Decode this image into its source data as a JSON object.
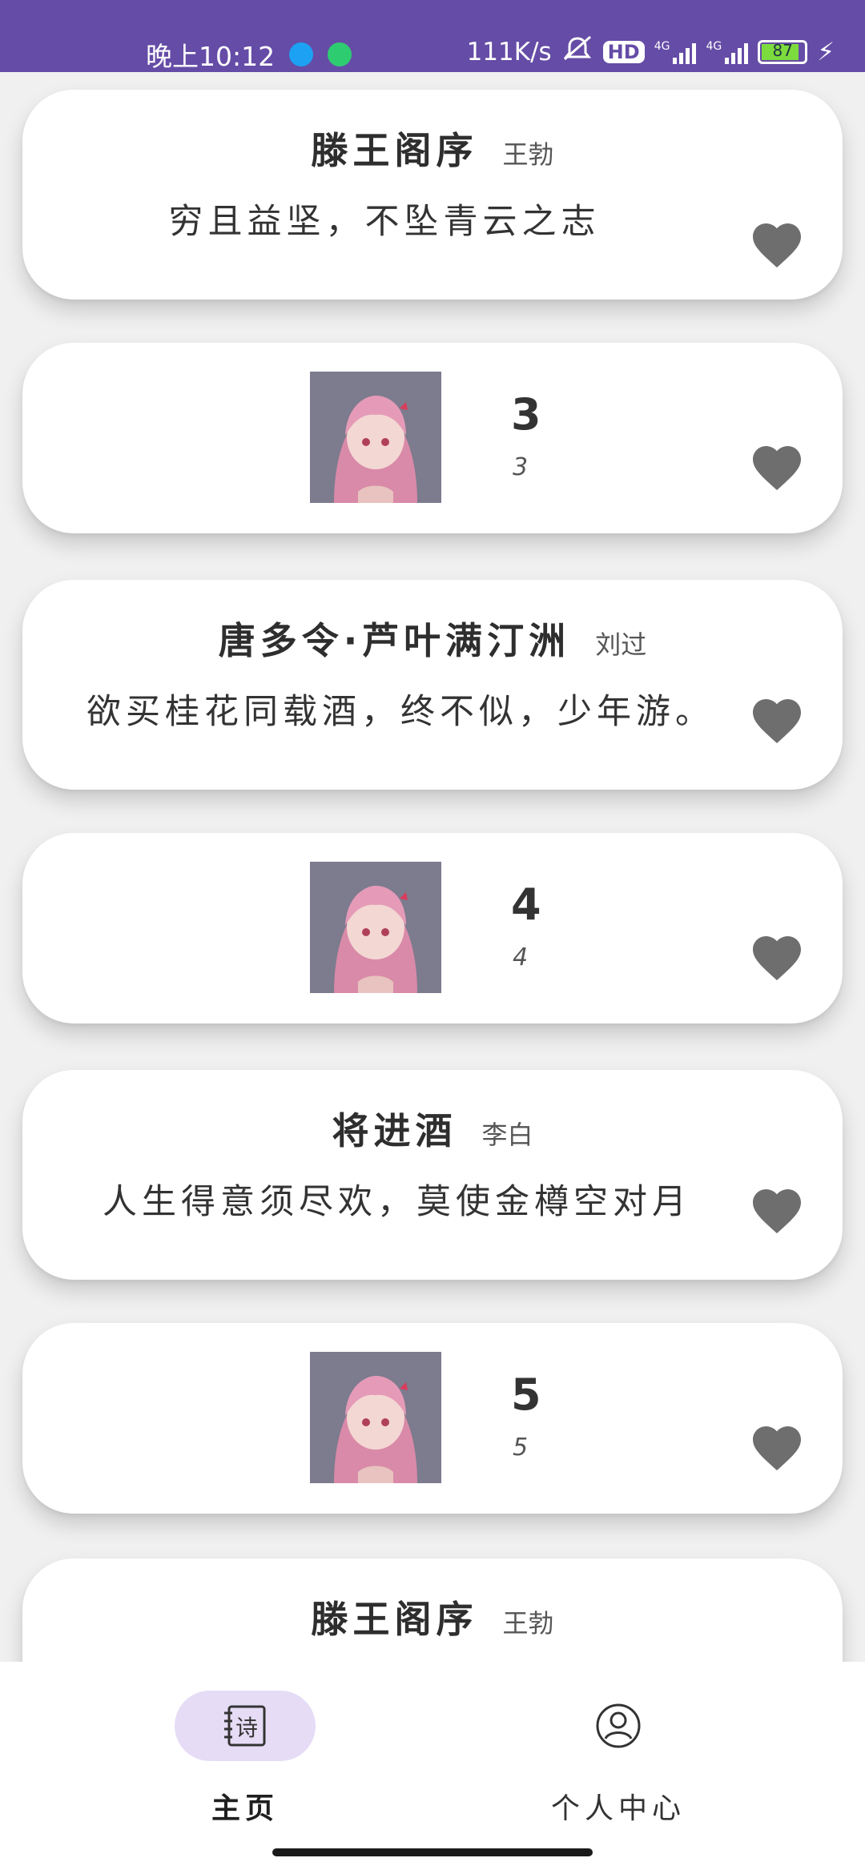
{
  "status_bar": {
    "time": "晚上10:12",
    "network_speed": "111K/s",
    "hd_label": "HD",
    "signal_label": "4G",
    "battery": "87",
    "icons": [
      "video-app-icon",
      "android-app-icon",
      "mute-icon",
      "signal-icon",
      "battery-icon",
      "charging-icon"
    ]
  },
  "feed": {
    "cards": [
      {
        "type": "poem",
        "title": "滕王阁序",
        "author": "王勃",
        "line": "穷且益坚，不坠青云之志"
      },
      {
        "type": "image",
        "number": "3",
        "caption": "3"
      },
      {
        "type": "poem",
        "title": "唐多令·芦叶满汀洲",
        "author": "刘过",
        "line": "欲买桂花同载酒，终不似，少年游。"
      },
      {
        "type": "image",
        "number": "4",
        "caption": "4"
      },
      {
        "type": "poem",
        "title": "将进酒",
        "author": "李白",
        "line": "人生得意须尽欢，莫使金樽空对月"
      },
      {
        "type": "image",
        "number": "5",
        "caption": "5"
      },
      {
        "type": "poem",
        "title": "滕王阁序",
        "author": "王勃",
        "line": ""
      }
    ]
  },
  "bottom_nav": {
    "home_icon_text": "诗",
    "items": [
      {
        "label": "主页",
        "active": true
      },
      {
        "label": "个人中心",
        "active": false
      }
    ]
  },
  "colors": {
    "status_bar": "#654ca6",
    "heart": "#6e6e6e",
    "active_pill": "#e6dcf6",
    "background": "#f1f0f1"
  }
}
